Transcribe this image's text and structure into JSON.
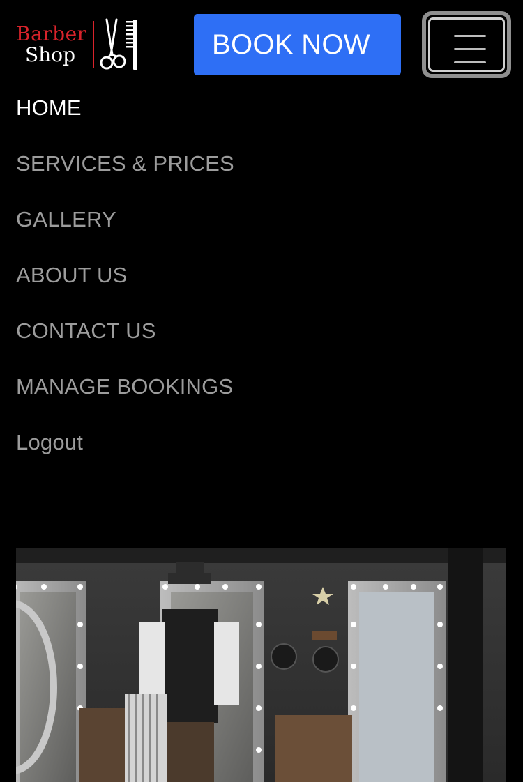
{
  "header": {
    "logo_word1": "Barber",
    "logo_word2": "Shop",
    "book_label": "BOOK NOW",
    "menu_icon": "hamburger-menu-icon"
  },
  "nav": {
    "items": [
      {
        "label": "HOME",
        "active": true
      },
      {
        "label": "SERVICES & PRICES",
        "active": false
      },
      {
        "label": "GALLERY",
        "active": false
      },
      {
        "label": "ABOUT US",
        "active": false
      },
      {
        "label": "CONTACT US",
        "active": false
      },
      {
        "label": "MANAGE BOOKINGS",
        "active": false
      },
      {
        "label": "Logout",
        "active": false
      }
    ]
  },
  "colors": {
    "background": "#000000",
    "brand_red": "#d9232b",
    "book_button": "#2e6ff5",
    "nav_inactive": "#9c9c9c",
    "nav_active": "#ffffff"
  }
}
